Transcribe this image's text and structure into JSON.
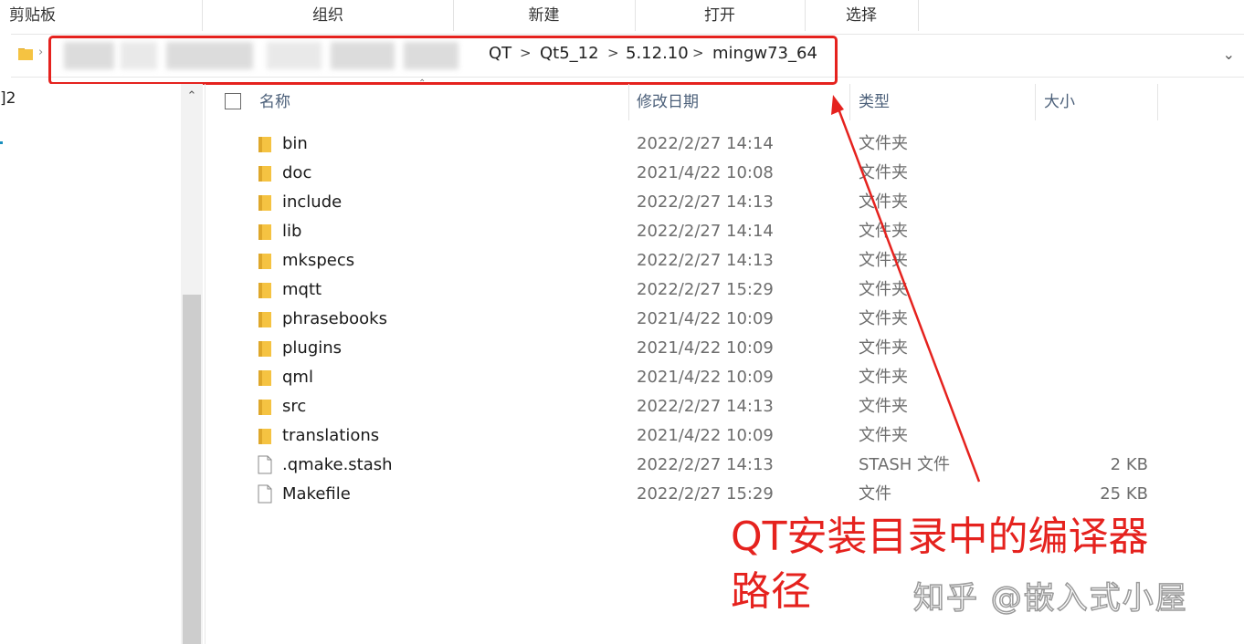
{
  "ribbon": {
    "groups": [
      "剪贴板",
      "组织",
      "新建",
      "打开",
      "选择"
    ]
  },
  "address": {
    "crumbs": [
      "QT",
      "Qt5_12",
      "5.12.10",
      "mingw73_64"
    ],
    "separator": ">",
    "dropdown_icon": "chevron-down-icon"
  },
  "nav": {
    "partial_label": "]2"
  },
  "columns": {
    "name": "名称",
    "modified": "修改日期",
    "type": "类型",
    "size": "大小"
  },
  "files": [
    {
      "name": "bin",
      "date": "2022/2/27 14:14",
      "type": "文件夹",
      "size": "",
      "kind": "folder"
    },
    {
      "name": "doc",
      "date": "2021/4/22 10:08",
      "type": "文件夹",
      "size": "",
      "kind": "folder"
    },
    {
      "name": "include",
      "date": "2022/2/27 14:13",
      "type": "文件夹",
      "size": "",
      "kind": "folder"
    },
    {
      "name": "lib",
      "date": "2022/2/27 14:14",
      "type": "文件夹",
      "size": "",
      "kind": "folder"
    },
    {
      "name": "mkspecs",
      "date": "2022/2/27 14:13",
      "type": "文件夹",
      "size": "",
      "kind": "folder"
    },
    {
      "name": "mqtt",
      "date": "2022/2/27 15:29",
      "type": "文件夹",
      "size": "",
      "kind": "folder"
    },
    {
      "name": "phrasebooks",
      "date": "2021/4/22 10:09",
      "type": "文件夹",
      "size": "",
      "kind": "folder"
    },
    {
      "name": "plugins",
      "date": "2021/4/22 10:09",
      "type": "文件夹",
      "size": "",
      "kind": "folder"
    },
    {
      "name": "qml",
      "date": "2021/4/22 10:09",
      "type": "文件夹",
      "size": "",
      "kind": "folder"
    },
    {
      "name": "src",
      "date": "2022/2/27 14:13",
      "type": "文件夹",
      "size": "",
      "kind": "folder"
    },
    {
      "name": "translations",
      "date": "2021/4/22 10:09",
      "type": "文件夹",
      "size": "",
      "kind": "folder"
    },
    {
      "name": ".qmake.stash",
      "date": "2022/2/27 14:13",
      "type": "STASH 文件",
      "size": "2 KB",
      "kind": "file"
    },
    {
      "name": "Makefile",
      "date": "2022/2/27 15:29",
      "type": "文件",
      "size": "25 KB",
      "kind": "file"
    }
  ],
  "annotation": {
    "line1": "QT安装目录中的编译器",
    "line2": "路径",
    "color": "#e5221e"
  },
  "watermark": "知乎 @嵌入式小屋",
  "colors": {
    "folder": "#f5c342",
    "folder_dark": "#dea72a",
    "highlight": "#e5221e"
  }
}
